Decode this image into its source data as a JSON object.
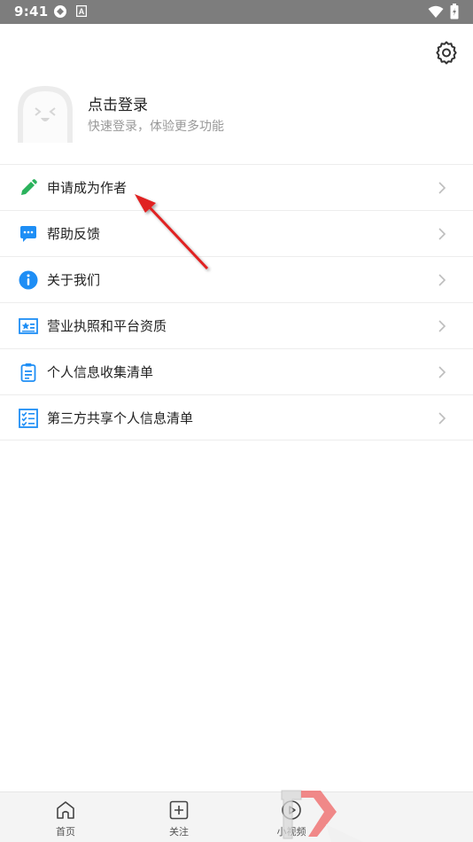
{
  "status_bar": {
    "time": "9:41",
    "app_icon_1": "sync-icon",
    "app_icon_2": "a-icon",
    "wifi": "wifi-icon",
    "battery": "battery-icon"
  },
  "header": {
    "settings_icon": "gear-icon"
  },
  "profile": {
    "title": "点击登录",
    "subtitle": "快速登录，体验更多功能",
    "avatar_icon": "face-avatar-icon"
  },
  "menu": {
    "items": [
      {
        "label": "申请成为作者",
        "icon": "pencil-icon",
        "color": "#2bb25c"
      },
      {
        "label": "帮助反馈",
        "icon": "chat-bubble-icon",
        "color": "#1e8ef5"
      },
      {
        "label": "关于我们",
        "icon": "info-icon",
        "color": "#1e8ef5"
      },
      {
        "label": "营业执照和平台资质",
        "icon": "license-icon",
        "color": "#1e8ef5"
      },
      {
        "label": "个人信息收集清单",
        "icon": "clipboard-icon",
        "color": "#1e8ef5"
      },
      {
        "label": "第三方共享个人信息清单",
        "icon": "checklist-icon",
        "color": "#1e8ef5"
      }
    ]
  },
  "tabbar": {
    "tabs": [
      {
        "label": "首页",
        "icon": "home-icon"
      },
      {
        "label": "关注",
        "icon": "plus-square-icon"
      },
      {
        "label": "小视频",
        "icon": "play-circle-icon"
      }
    ]
  },
  "annotation": {
    "color": "#e02020"
  }
}
